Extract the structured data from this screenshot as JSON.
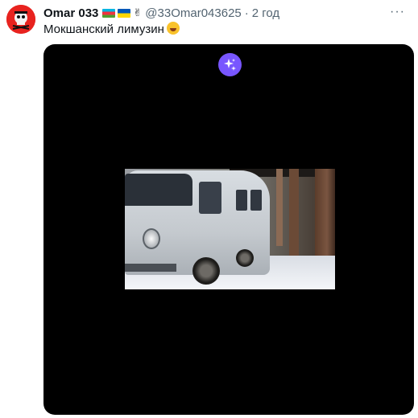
{
  "tweet": {
    "author_name": "Omar 033",
    "author_flags": [
      "azerbaijan-flag",
      "ukraine-flag"
    ],
    "author_extra_emoji": "✌",
    "handle": "@33Omar043625",
    "separator": "·",
    "time": "2 год",
    "more_label": "···",
    "text": "Мокшанский лимузин",
    "text_emoji": "rolling-on-the-floor-laughing-emoji"
  },
  "media": {
    "badge_icon": "sparkles-icon",
    "badge_color": "#7856ff",
    "background": "#000000"
  },
  "colors": {
    "avatar_bg": "#e8231f",
    "text_primary": "#0f1419",
    "text_secondary": "#536471"
  }
}
